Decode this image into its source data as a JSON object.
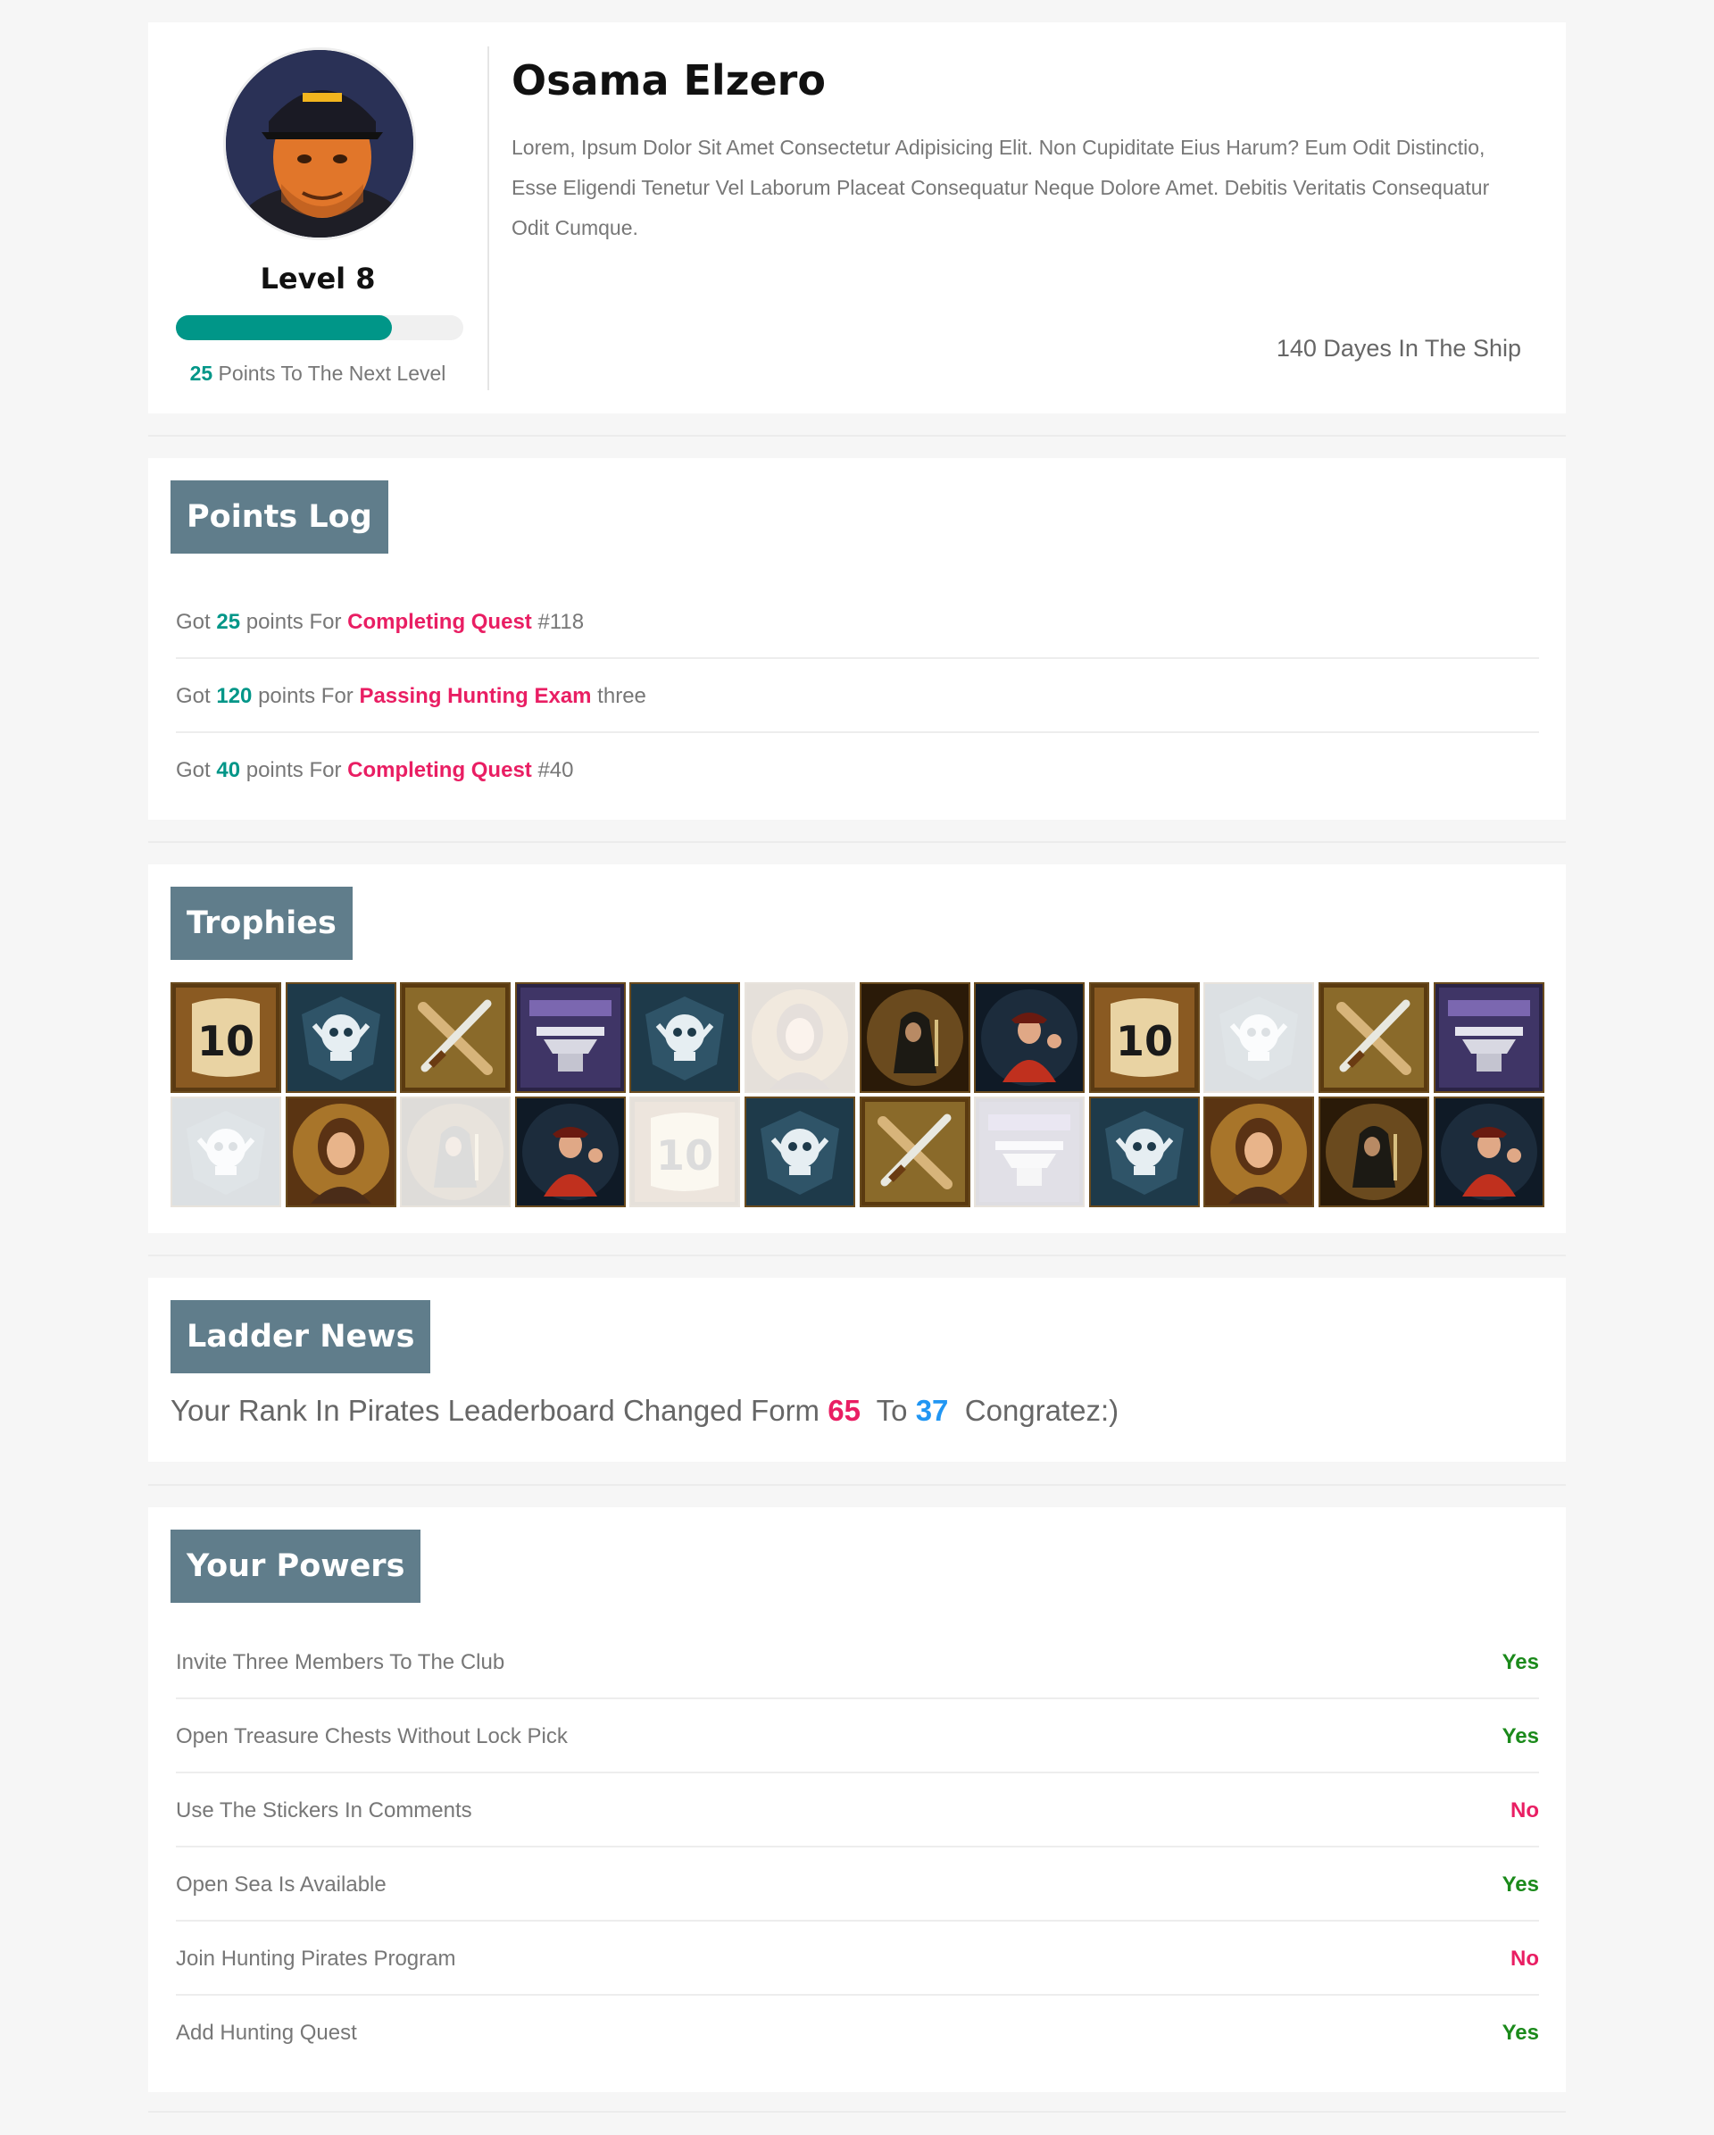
{
  "profile": {
    "name": "Osama Elzero",
    "level": "Level 8",
    "progress_percent": 75,
    "next_points": "25",
    "next_text": " Points To The Next Level",
    "bio": "Lorem, Ipsum Dolor Sit Amet Consectetur Adipisicing Elit. Non Cupiditate Eius Harum? Eum Odit Distinctio, Esse Eligendi Tenetur Vel Laborum Placeat Consequatur Neque Dolore Amet. Debitis Veritatis Consequatur Odit Cumque.",
    "days": "140 Dayes In The Ship"
  },
  "points_log": {
    "title": "Points Log",
    "entries": [
      {
        "pre": "Got ",
        "points": "25",
        "mid": " points For ",
        "action": "Completing Quest",
        "post": " #118"
      },
      {
        "pre": "Got ",
        "points": "120",
        "mid": " points For ",
        "action": "Passing Hunting Exam",
        "post": " three"
      },
      {
        "pre": "Got ",
        "points": "40",
        "mid": " points For ",
        "action": "Completing Quest",
        "post": " #40"
      }
    ]
  },
  "trophies": {
    "title": "Trophies",
    "items": [
      {
        "icon": "scroll-10-icon",
        "faded": false
      },
      {
        "icon": "skull-shield-icon",
        "faded": false
      },
      {
        "icon": "crossed-weapons-icon",
        "faded": false
      },
      {
        "icon": "swords-anvil-icon",
        "faded": false
      },
      {
        "icon": "skull-shield-icon",
        "faded": false
      },
      {
        "icon": "pirate-woman-icon",
        "faded": true
      },
      {
        "icon": "hooded-pirate-icon",
        "faded": false
      },
      {
        "icon": "red-pirate-icon",
        "faded": false
      },
      {
        "icon": "scroll-10-icon",
        "faded": false
      },
      {
        "icon": "skull-shield-icon",
        "faded": true
      },
      {
        "icon": "crossed-weapons-icon",
        "faded": false
      },
      {
        "icon": "swords-anvil-icon",
        "faded": false
      },
      {
        "icon": "skull-shield-icon",
        "faded": true
      },
      {
        "icon": "pirate-woman-icon",
        "faded": false
      },
      {
        "icon": "hooded-pirate-icon",
        "faded": true
      },
      {
        "icon": "red-pirate-icon",
        "faded": false
      },
      {
        "icon": "scroll-10-icon",
        "faded": true
      },
      {
        "icon": "skull-shield-icon",
        "faded": false
      },
      {
        "icon": "crossed-weapons-icon",
        "faded": false
      },
      {
        "icon": "swords-anvil-icon",
        "faded": true
      },
      {
        "icon": "skull-shield-icon",
        "faded": false
      },
      {
        "icon": "pirate-woman-icon",
        "faded": false
      },
      {
        "icon": "hooded-pirate-icon",
        "faded": false
      },
      {
        "icon": "red-pirate-icon",
        "faded": false
      }
    ]
  },
  "ladder": {
    "title": "Ladder News",
    "pre": "Your Rank In Pirates Leaderboard Changed Form ",
    "from": "65",
    "mid": "  To ",
    "to": "37",
    "post": "  Congratez:)"
  },
  "powers": {
    "title": "Your Powers",
    "items": [
      {
        "label": "Invite Three Members To The Club",
        "value": "Yes"
      },
      {
        "label": "Open Treasure Chests Without Lock Pick",
        "value": "Yes"
      },
      {
        "label": "Use The Stickers In Comments",
        "value": "No"
      },
      {
        "label": "Open Sea Is Available",
        "value": "Yes"
      },
      {
        "label": "Join Hunting Pirates Program",
        "value": "No"
      },
      {
        "label": "Add Hunting Quest",
        "value": "Yes"
      }
    ]
  },
  "colors": {
    "accent": "#009688",
    "pink": "#e91e63",
    "blue": "#2196f3",
    "header_bg": "#607d8b",
    "yes": "#1b8a1b"
  }
}
